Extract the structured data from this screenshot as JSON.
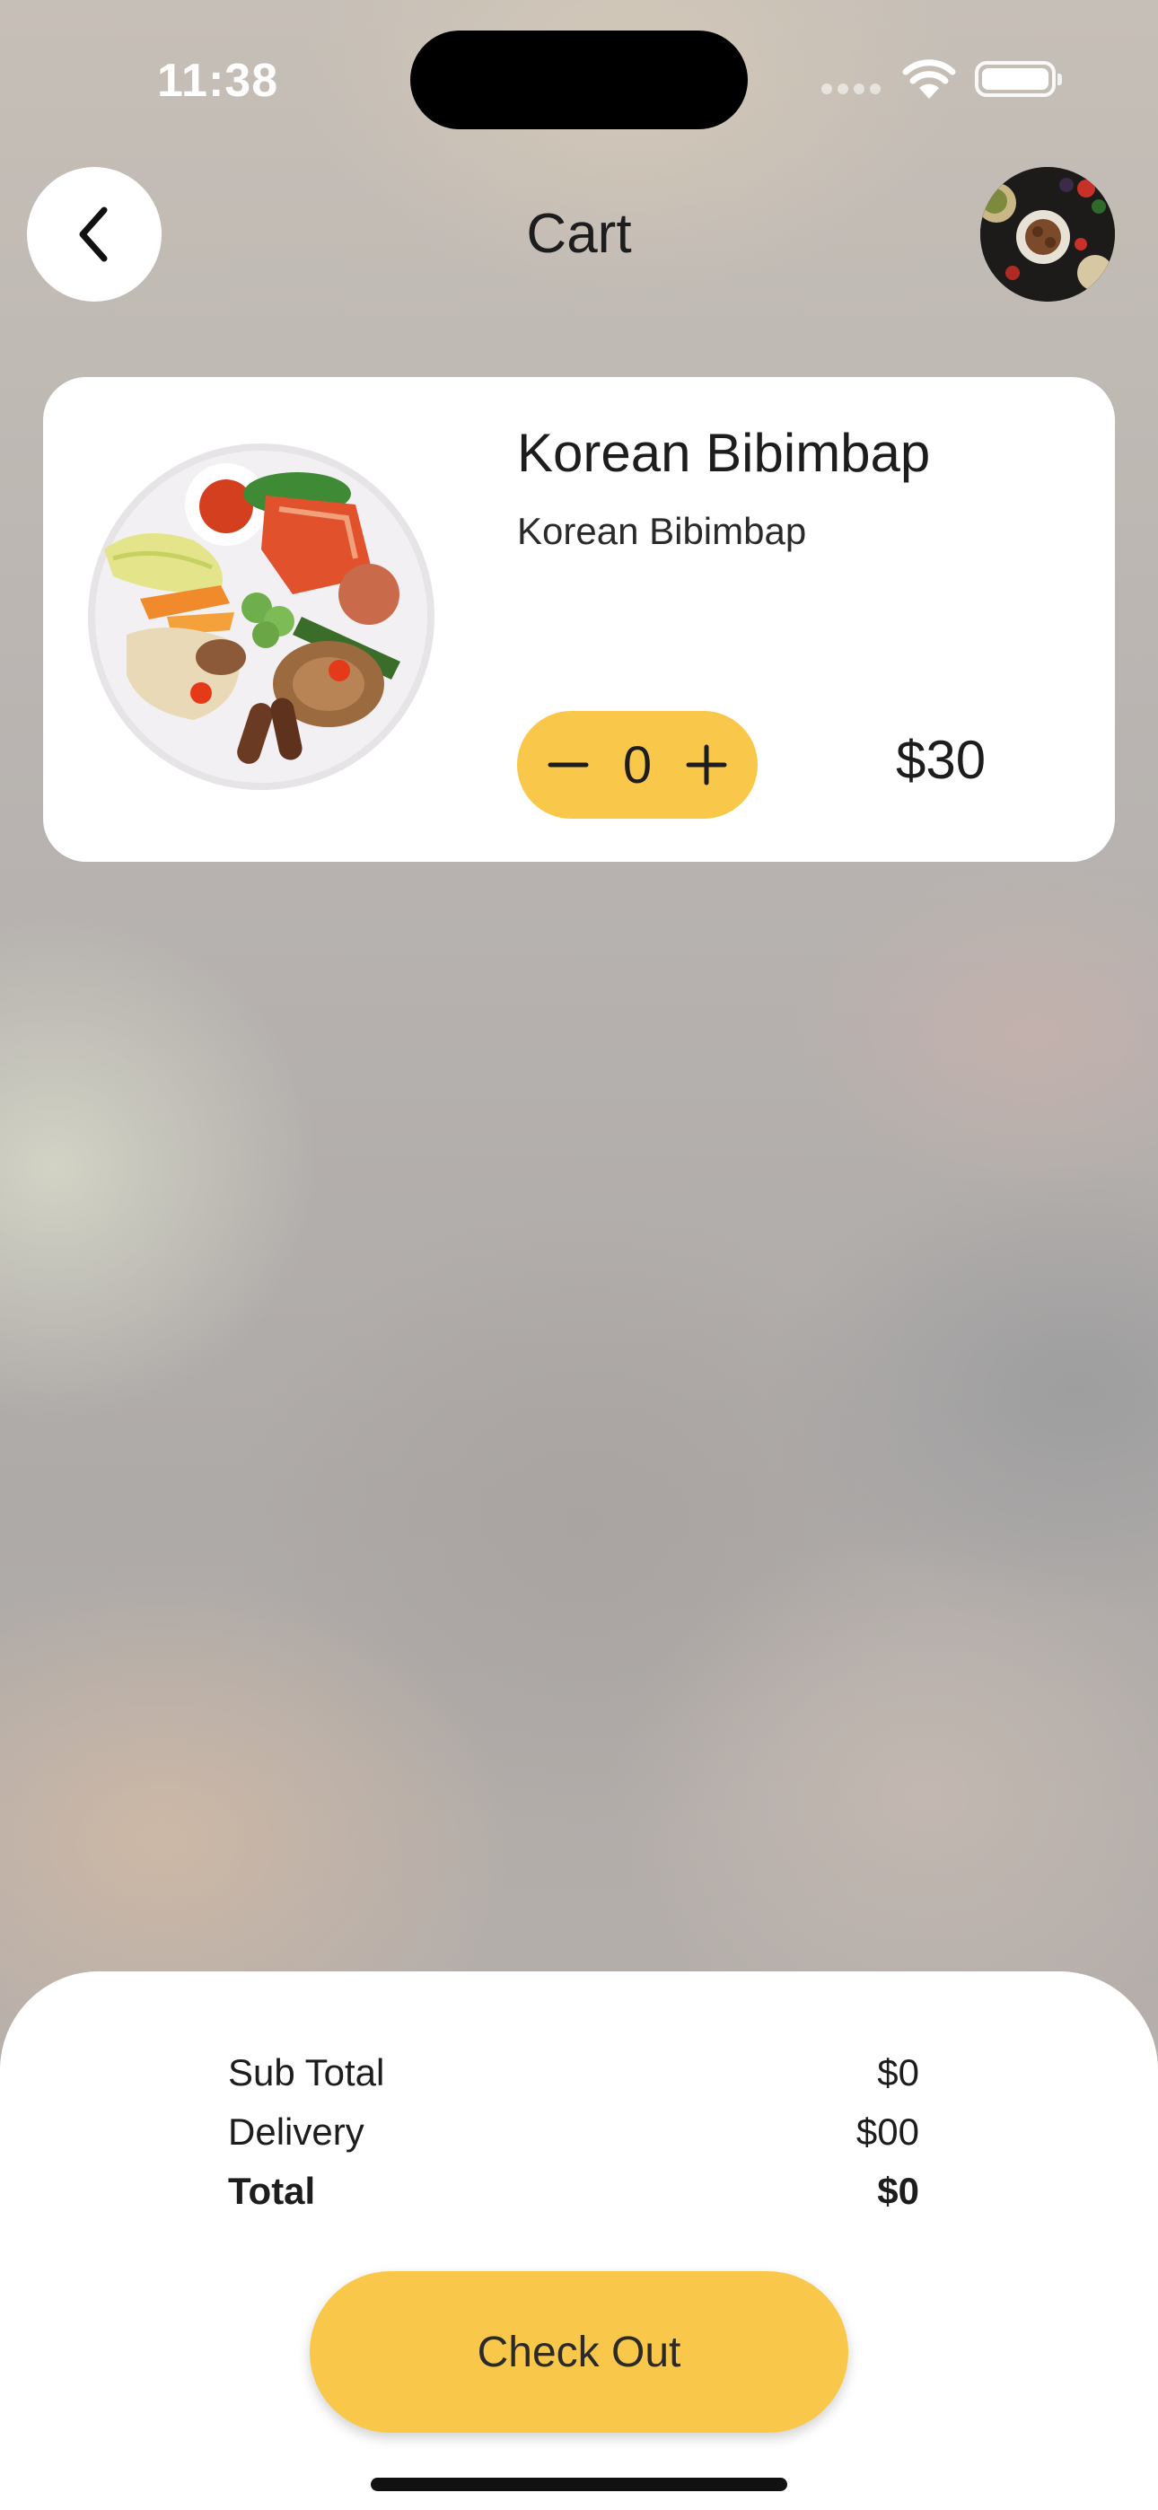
{
  "status_bar": {
    "time": "11:38"
  },
  "header": {
    "title": "Cart",
    "back_icon": "chevron-left-icon",
    "avatar_description": "food-collage"
  },
  "cart": {
    "items": [
      {
        "name": "Korean Bibimbap",
        "description": "Korean Bibimbap",
        "quantity": "0",
        "price": "$30",
        "decrement_icon": "minus-icon",
        "increment_icon": "plus-icon"
      }
    ]
  },
  "summary": {
    "subtotal_label": "Sub Total",
    "subtotal_value": "$0",
    "delivery_label": "Delivery",
    "delivery_value": "$00",
    "total_label": "Total",
    "total_value": "$0"
  },
  "checkout": {
    "label": "Check Out"
  },
  "colors": {
    "accent": "#f9c74a",
    "card": "#ffffff",
    "text": "#1d1d1d"
  }
}
